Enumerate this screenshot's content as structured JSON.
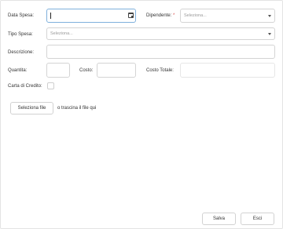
{
  "form": {
    "data_spesa_label": "Data Spesa:",
    "data_spesa_value": "",
    "dipendente_label": "Dipendente:",
    "dipendente_required": "*",
    "dipendente_placeholder": "Seleziona...",
    "tipo_spesa_label": "Tipo Spesa:",
    "tipo_spesa_placeholder": "Seleziona...",
    "descrizione_label": "Descrizione:",
    "quantita_label": "Quantita:",
    "costo_label": "Costo:",
    "costo_totale_label": "Costo Totale:",
    "carta_credito_label": "Carta di Credito:"
  },
  "upload": {
    "button_label": "Seleziona file",
    "hint": "o trascina il file qui"
  },
  "footer": {
    "save_label": "Salva",
    "exit_label": "Esci"
  },
  "colors": {
    "border": "#d4d4d4",
    "focus_border": "#7fb0dc",
    "required": "#d9534f"
  }
}
